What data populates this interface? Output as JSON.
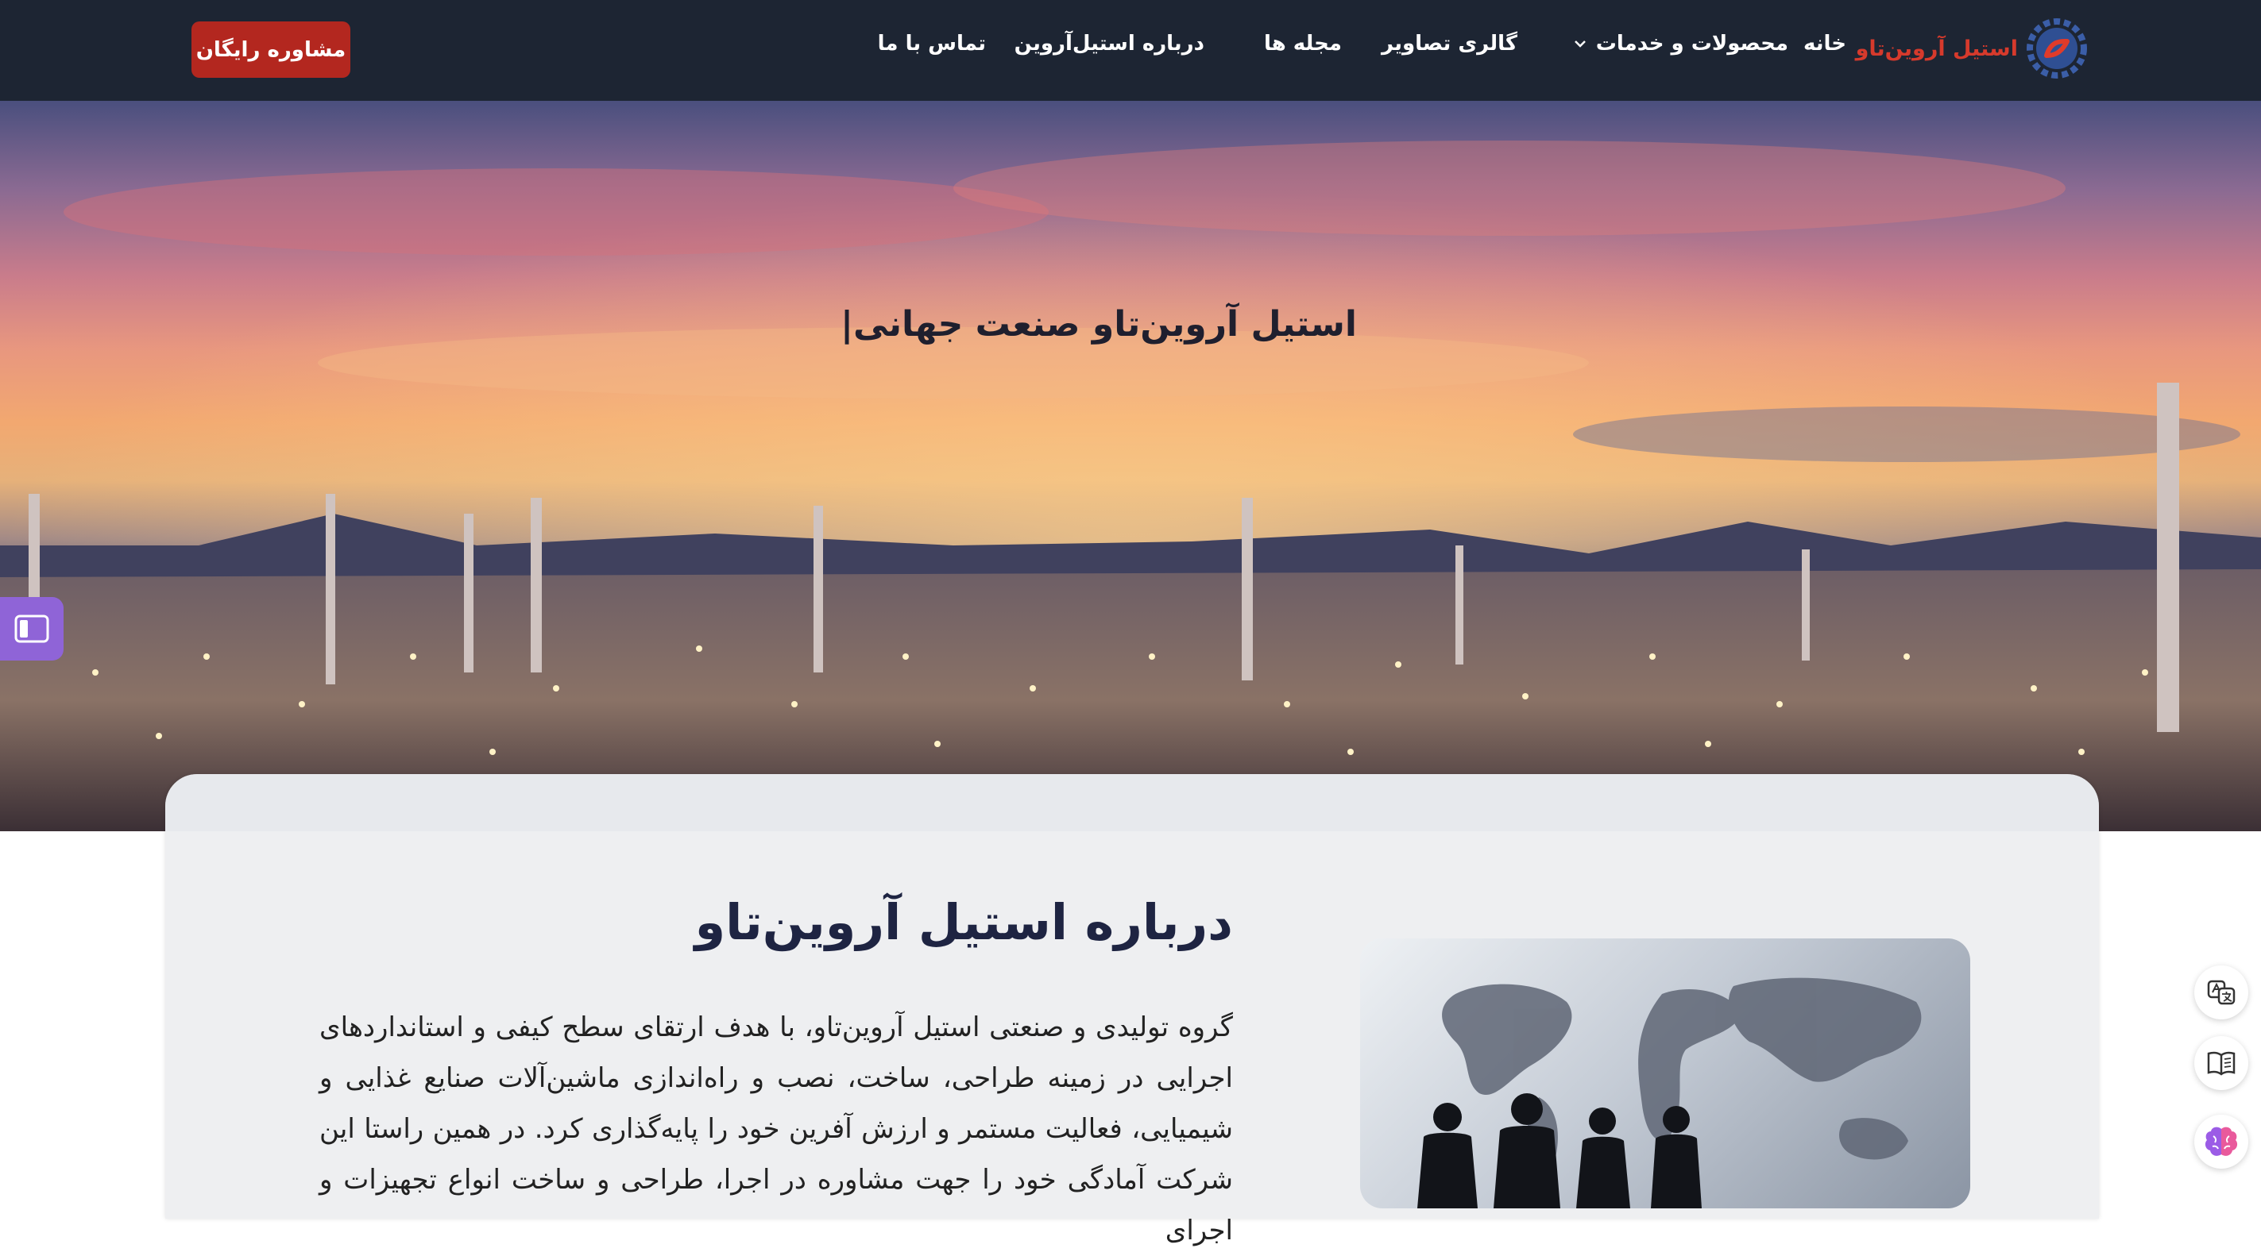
{
  "header": {
    "brand_name": "استیل آروین‌تاو",
    "nav": {
      "home": "خانه",
      "products": "محصولات و خدمات",
      "gallery": "گالری تصاویر",
      "magazine": "مجله ها",
      "about": "درباره استیل‌آروین",
      "contact": "تماس با ما"
    },
    "cta_label": "مشاوره رایگان"
  },
  "hero": {
    "title": "استیل آروین‌تاو صنعت جهانی|"
  },
  "about": {
    "title": "درباره استیل آروین‌تاو",
    "paragraph": "گروه تولیدی و صنعتی استیل آروین‌تاو، با هدف ارتقای سطح کیفی و استانداردهای اجرایی در زمینه طراحی، ساخت، نصب و راه‌اندازی ماشین‌آلات صنایع غذایی و شیمیایی، فعالیت مستمر و ارزش آفرین خود را پایه‌گذاری کرد. در همین راستا این شرکت آمادگی خود را جهت مشاوره در اجرا، طراحی و ساخت انواع تجهیزات و اجرای"
  },
  "colors": {
    "navbar": "#1d2533",
    "brand_red": "#d63a2c",
    "cta": "#b3271f",
    "toggle": "#8f64d7",
    "card": "#eeeff1",
    "title_dark": "#1e2442"
  },
  "icons": [
    "gear-logo-icon",
    "chevron-down-icon",
    "sidebar-toggle-icon",
    "translate-icon",
    "reader-icon",
    "brain-icon"
  ]
}
